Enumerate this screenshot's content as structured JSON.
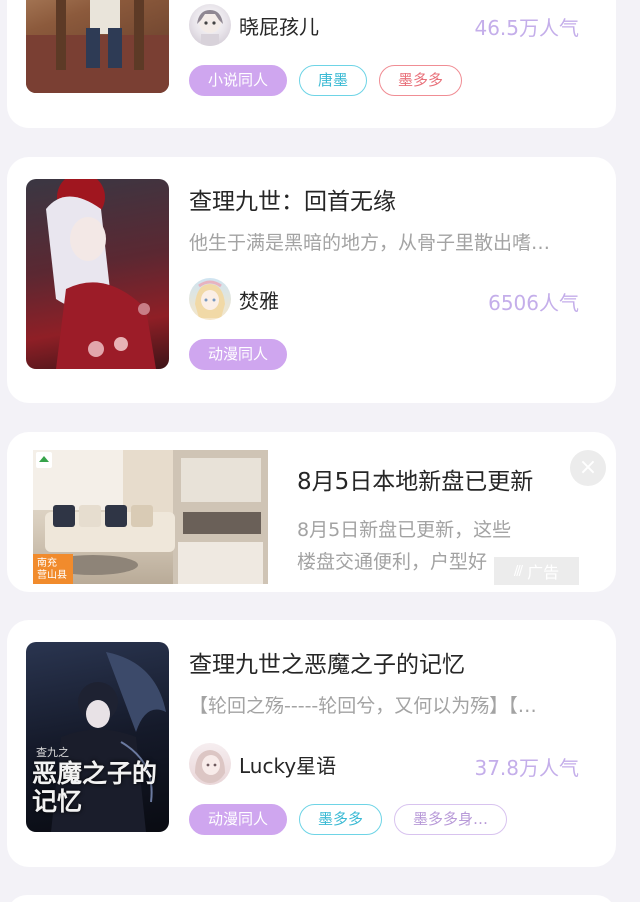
{
  "cards": [
    {
      "title": "",
      "desc": "",
      "author": "晓屁孩儿",
      "popularity": "46.5万人气",
      "tags": [
        "小说同人",
        "唐墨",
        "墨多多"
      ]
    },
    {
      "title": "查理九世：回首无缘",
      "desc": "他生于满是黑暗的地方，从骨子里散出嗜…",
      "author": "焚雅",
      "popularity": "6506人气",
      "tags": [
        "动漫同人"
      ]
    },
    {
      "title": "查理九世之恶魔之子的记忆",
      "desc": "【轮回之殇-----轮回兮，又何以为殇】【…",
      "author": "Lucky星语",
      "popularity": "37.8万人气",
      "tags": [
        "动漫同人",
        "墨多多",
        "墨多多身…"
      ],
      "cover_text": "恶魔之子的记忆",
      "cover_small": "查九之"
    }
  ],
  "ad": {
    "title": "8月5日本地新盘已更新",
    "desc_line1": "8月5日新盘已更新，这些",
    "desc_line2": "楼盘交通便利，户型好",
    "badge": "广告",
    "close": "×",
    "location_city": "南充",
    "location_county": "营山县"
  },
  "colors": {
    "tag_fill": "#cfa6ef",
    "tag_cyan": "#6ed4e6",
    "tag_red": "#f08d94",
    "popularity": "#c4aeea"
  }
}
